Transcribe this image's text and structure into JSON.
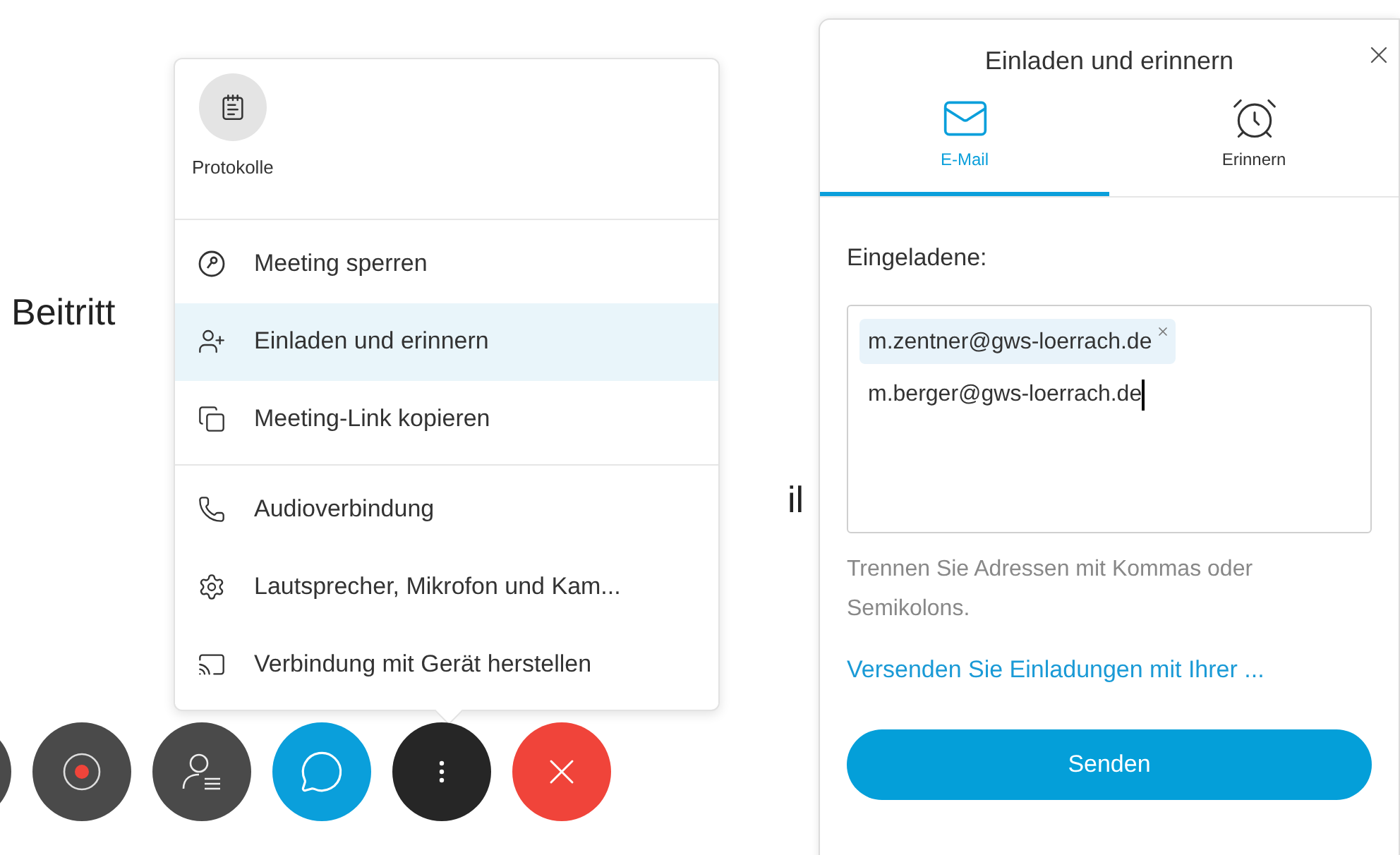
{
  "background": {
    "texts": [
      {
        "text": "Beitritt",
        "kind": "left"
      },
      {
        "text": "il",
        "kind": "right"
      }
    ]
  },
  "menu": {
    "tiles": [
      {
        "label": "Protokolle",
        "kind": "notes"
      }
    ],
    "sections": [
      [
        {
          "label": "Meeting sperren",
          "kind": "lock",
          "selected": false
        },
        {
          "label": "Einladen und erinnern",
          "kind": "invite",
          "selected": true
        },
        {
          "label": "Meeting-Link kopieren",
          "kind": "copy",
          "selected": false
        }
      ],
      [
        {
          "label": "Audioverbindung",
          "kind": "phone",
          "selected": false
        },
        {
          "label": "Lautsprecher, Mikrofon und Kam...",
          "kind": "settings",
          "selected": false
        },
        {
          "label": "Verbindung mit Gerät herstellen",
          "kind": "cast",
          "selected": false
        }
      ]
    ]
  },
  "toolbar": {
    "buttons": [
      {
        "kind": "partial"
      },
      {
        "kind": "record"
      },
      {
        "kind": "participants"
      },
      {
        "kind": "chat"
      },
      {
        "kind": "more"
      },
      {
        "kind": "leave"
      }
    ]
  },
  "panel": {
    "title": "Einladen und erinnern",
    "tabs": [
      {
        "label": "E-Mail",
        "kind": "mail",
        "selected": true
      },
      {
        "label": "Erinnern",
        "kind": "alarm",
        "selected": false
      }
    ],
    "invitees_label": "Eingeladene:",
    "tokens": [
      {
        "text": "m.zentner@gws-loerrach.de"
      }
    ],
    "value": "m.berger@gws-loerrach.de",
    "hint": "Trennen Sie Adressen mit Kommas oder Semikolons.",
    "link": "Versenden Sie Einladungen mit Ihrer ...",
    "send": "Senden"
  }
}
